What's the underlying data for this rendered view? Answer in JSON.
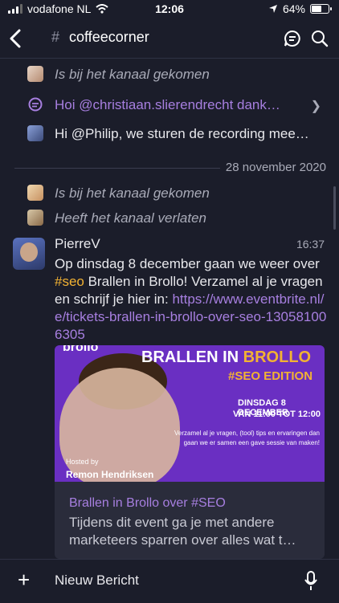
{
  "status": {
    "carrier": "vodafone NL",
    "time": "12:06",
    "battery": "64%",
    "battery_level": 0.64
  },
  "header": {
    "hash": "#",
    "channel": "coffeecorner"
  },
  "feed": {
    "joined1": "Is bij het kanaal gekomen",
    "thread_preview": "Hoi @christiaan.slierendrecht dank…",
    "message_preview": "Hi @Philip, we sturen de recording mee…",
    "date_separator": "28 november 2020",
    "joined2": "Is bij het kanaal gekomen",
    "left": "Heeft het kanaal verlaten"
  },
  "post": {
    "author": "PierreV",
    "time": "16:37",
    "text_before": "Op dinsdag 8 december gaan we weer over ",
    "hashtag": "#seo",
    "text_after": " Brallen in Brollo! Verzamel al je vragen en schrijf je hier in: ",
    "url": "https://www.eventbrite.nl/e/tickets-brallen-in-brollo-over-seo-130581006305"
  },
  "card": {
    "brand": "brollo",
    "title_main": "BRALLEN IN ",
    "title_accent": "BROLLO",
    "edition": "#SEO EDITION",
    "date": "DINSDAG 8 DECEMBER",
    "time_range": "VAN 11:00 TOT 12:00",
    "description": "Verzamel al je vragen, (tool) tips en ervaringen dan gaan we er samen een gave sessie van maken!",
    "hosted_by": "Hosted by",
    "host": "Remon Hendriksen",
    "link_title": "Brallen in Brollo over #SEO",
    "link_description": "Tijdens dit event ga je met andere marketeers sparren over alles wat t…"
  },
  "composer": {
    "plus": "+",
    "placeholder": "Nieuw Bericht"
  },
  "colors": {
    "background": "#1b1d2a",
    "accent_purple": "#a77fe0",
    "hashtag": "#f2b233"
  }
}
